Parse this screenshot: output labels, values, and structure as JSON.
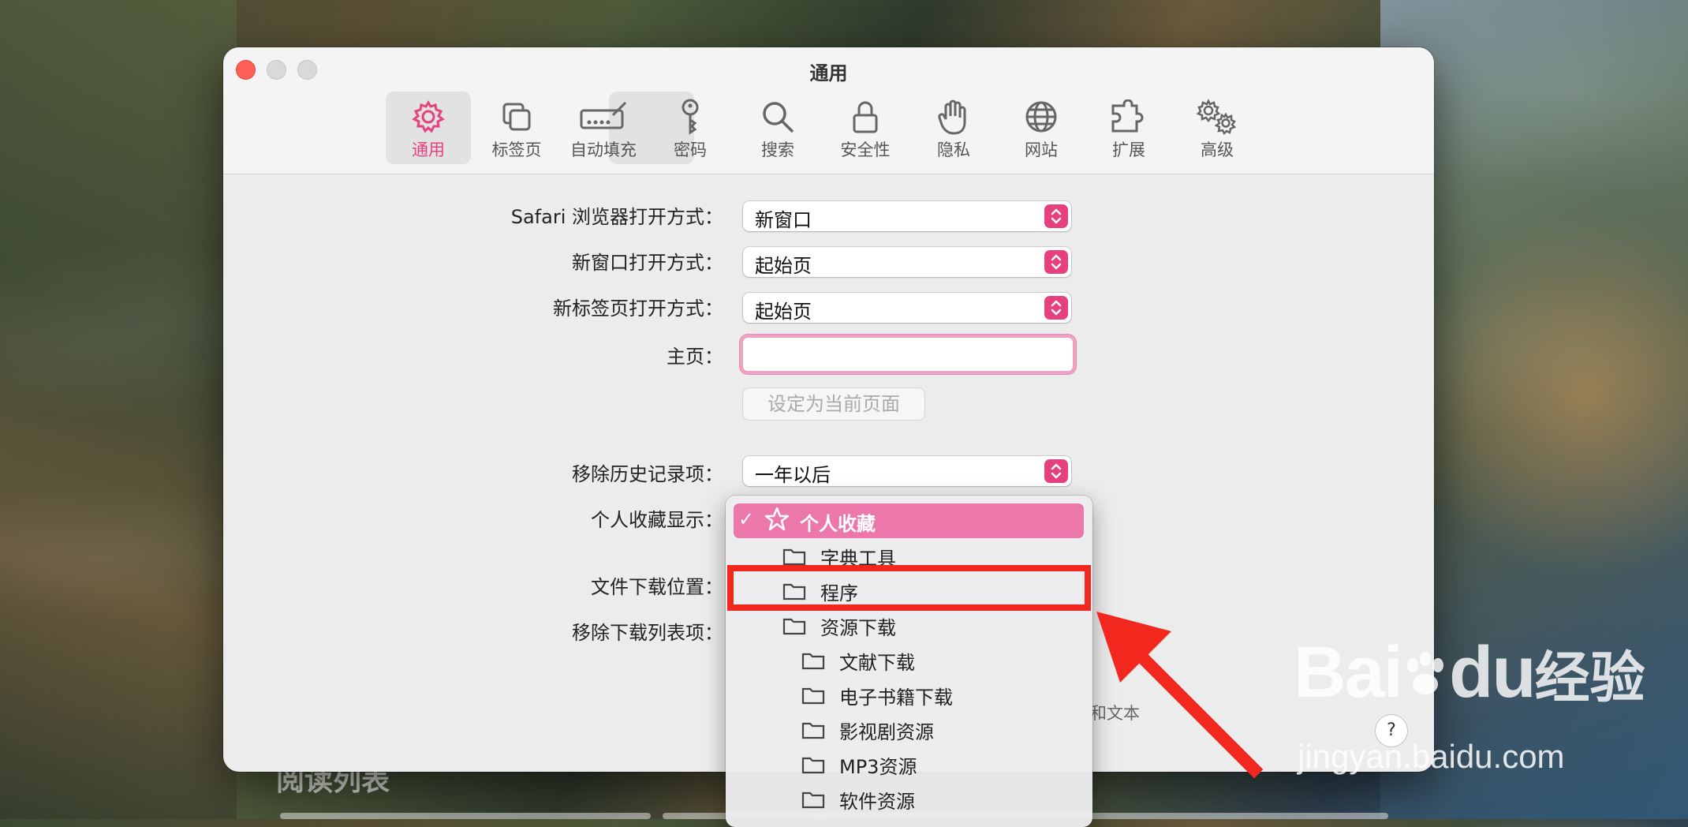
{
  "window": {
    "title": "通用"
  },
  "toolbar": {
    "items": [
      {
        "label": "通用",
        "icon": "gear-icon",
        "active": true
      },
      {
        "label": "标签页",
        "icon": "tabs-icon"
      },
      {
        "label": "自动填充",
        "icon": "autofill-icon"
      },
      {
        "label": "密码",
        "icon": "key-icon"
      },
      {
        "label": "搜索",
        "icon": "search-icon"
      },
      {
        "label": "安全性",
        "icon": "lock-icon"
      },
      {
        "label": "隐私",
        "icon": "hand-icon"
      },
      {
        "label": "网站",
        "icon": "globe-icon"
      },
      {
        "label": "扩展",
        "icon": "puzzle-icon"
      },
      {
        "label": "高级",
        "icon": "gears-icon"
      }
    ]
  },
  "settings": {
    "safari_open_label": "Safari 浏览器打开方式：",
    "safari_open_value": "新窗口",
    "new_window_label": "新窗口打开方式：",
    "new_window_value": "起始页",
    "new_tab_label": "新标签页打开方式：",
    "new_tab_value": "起始页",
    "homepage_label": "主页：",
    "homepage_value": "",
    "set_current_label": "设定为当前页面",
    "remove_history_label": "移除历史记录项：",
    "remove_history_value": "一年以后",
    "favorites_label": "个人收藏显示：",
    "download_location_label": "文件下载位置：",
    "remove_download_label": "移除下载列表项：",
    "faint_text": "和文本",
    "help_label": "?"
  },
  "menu": {
    "items": [
      {
        "label": "个人收藏",
        "selected": true,
        "indent": 0
      },
      {
        "label": "字典工具",
        "indent": 1
      },
      {
        "label": "程序",
        "indent": 1,
        "highlighted": true
      },
      {
        "label": "资源下载",
        "indent": 1
      },
      {
        "label": "文献下载",
        "indent": 2
      },
      {
        "label": "电子书籍下载",
        "indent": 2
      },
      {
        "label": "影视剧资源",
        "indent": 2
      },
      {
        "label": "MP3资源",
        "indent": 2
      },
      {
        "label": "软件资源",
        "indent": 2
      }
    ],
    "check_glyph": "✓"
  },
  "colors": {
    "accent": "#e6407f",
    "highlight_box": "#f2281f"
  },
  "watermark": {
    "brand": "Bai",
    "brand2": "du",
    "suffix": "经验",
    "url": "jingyan.baidu.com"
  },
  "background": {
    "reading_list": "阅读列表"
  }
}
